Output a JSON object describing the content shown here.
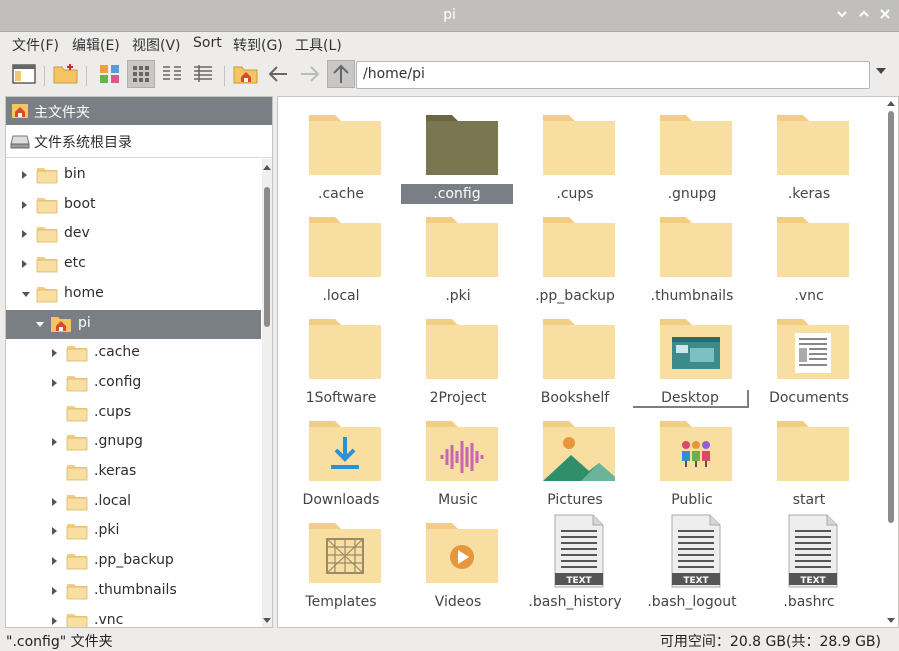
{
  "window": {
    "title": "pi"
  },
  "menu": [
    "文件(F)",
    "编辑(E)",
    "视图(V)",
    "Sort",
    "转到(G)",
    "工具(L)"
  ],
  "toolbar": {
    "path": "/home/pi"
  },
  "places": {
    "home_label": "主文件夹",
    "root_label": "文件系统根目录"
  },
  "tree": [
    {
      "label": "bin",
      "expander": "right"
    },
    {
      "label": "boot",
      "expander": "right"
    },
    {
      "label": "dev",
      "expander": "right"
    },
    {
      "label": "etc",
      "expander": "right"
    },
    {
      "label": "home",
      "expander": "down"
    },
    {
      "label": "pi",
      "expander": "down",
      "selected": true
    },
    {
      "label": ".cache",
      "expander": "right"
    },
    {
      "label": ".config",
      "expander": "right"
    },
    {
      "label": ".cups",
      "expander": "none"
    },
    {
      "label": ".gnupg",
      "expander": "right"
    },
    {
      "label": ".keras",
      "expander": "none"
    },
    {
      "label": ".local",
      "expander": "right"
    },
    {
      "label": ".pki",
      "expander": "right"
    },
    {
      "label": ".pp_backup",
      "expander": "right"
    },
    {
      "label": ".thumbnails",
      "expander": "right"
    },
    {
      "label": ".vnc",
      "expander": "right"
    }
  ],
  "files": [
    {
      "name": ".cache",
      "type": "folder"
    },
    {
      "name": ".config",
      "type": "folder",
      "selected": true
    },
    {
      "name": ".cups",
      "type": "folder"
    },
    {
      "name": ".gnupg",
      "type": "folder"
    },
    {
      "name": ".keras",
      "type": "folder"
    },
    {
      "name": ".local",
      "type": "folder"
    },
    {
      "name": ".pki",
      "type": "folder"
    },
    {
      "name": ".pp_backup",
      "type": "folder"
    },
    {
      "name": ".thumbnails",
      "type": "folder"
    },
    {
      "name": ".vnc",
      "type": "folder"
    },
    {
      "name": "1Software",
      "type": "folder"
    },
    {
      "name": "2Project",
      "type": "folder"
    },
    {
      "name": "Bookshelf",
      "type": "folder"
    },
    {
      "name": "Desktop",
      "type": "folder-desktop",
      "focused": true
    },
    {
      "name": "Documents",
      "type": "folder-documents"
    },
    {
      "name": "Downloads",
      "type": "folder-downloads"
    },
    {
      "name": "Music",
      "type": "folder-music"
    },
    {
      "name": "Pictures",
      "type": "folder-pictures"
    },
    {
      "name": "Public",
      "type": "folder-public"
    },
    {
      "name": "start",
      "type": "folder"
    },
    {
      "name": "Templates",
      "type": "folder-templates"
    },
    {
      "name": "Videos",
      "type": "folder-videos"
    },
    {
      "name": ".bash_history",
      "type": "text"
    },
    {
      "name": ".bash_logout",
      "type": "text"
    },
    {
      "name": ".bashrc",
      "type": "text"
    }
  ],
  "text_badge": "TEXT",
  "status": {
    "left": "\".config\" 文件夹",
    "right": "可用空间：20.8 GB(共：28.9 GB)"
  },
  "colors": {
    "folder": "#f8dea0",
    "folder_tab": "#f1ce83",
    "selected_folder": "#7a7650",
    "selection": "#7a7f85"
  }
}
